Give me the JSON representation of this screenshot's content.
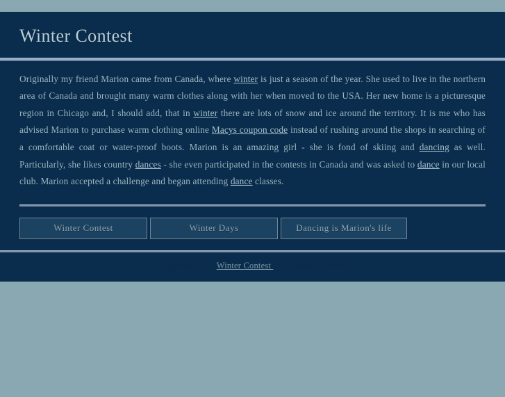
{
  "theme": {
    "page_background": "#8aa8b1",
    "content_background": "#0a2d4d",
    "body_text_color": "#9db4bf",
    "link_color": "#a9c0cb",
    "rule_color": "#93a9c4",
    "button_background": "#1b4260",
    "button_border": "#6f8797",
    "button_text_color": "#8ea4b0",
    "footer_text_color": "#0d2c44"
  },
  "header": {
    "title": "Winter Contest"
  },
  "article": {
    "segments": [
      {
        "type": "text",
        "value": "Originally my friend Marion came from Canada, where "
      },
      {
        "type": "link",
        "value": "winter"
      },
      {
        "type": "text",
        "value": " is just a season of the year. She used to live in the northern area of Canada and brought many warm clothes along with her when moved to the USA. Her new home is a picturesque region in Chicago and, I should add, that in "
      },
      {
        "type": "link",
        "value": "winter"
      },
      {
        "type": "text",
        "value": " there are lots of snow and ice around the territory. It is me who has advised Marion to purchase warm clothing online "
      },
      {
        "type": "link",
        "value": "Macys coupon code"
      },
      {
        "type": "text",
        "value": " instead of rushing around the shops in searching of a comfortable coat or water-proof boots. Marion is an amazing girl - she is fond of skiing and "
      },
      {
        "type": "link",
        "value": "dancing"
      },
      {
        "type": "text",
        "value": " as well. Particularly, she likes country "
      },
      {
        "type": "link",
        "value": "dances"
      },
      {
        "type": "text",
        "value": " - she even participated in the contests in Canada and was asked to "
      },
      {
        "type": "link",
        "value": "dance"
      },
      {
        "type": "text",
        "value": " in our local club. Marion accepted a challenge and began attending "
      },
      {
        "type": "link",
        "value": "dance"
      },
      {
        "type": "text",
        "value": " classes."
      }
    ],
    "text_1": "Originally my friend Marion came from Canada, where ",
    "link_winter_1": "winter",
    "text_2": " is just a season of the year. She used to live in the northern area of Canada and brought many warm clothes along with her when moved to the USA. Her new home is a picturesque region in Chicago and, I should add, that in ",
    "link_winter_2": "winter",
    "text_3": " there are lots of snow and ice around the territory. It is me who has advised Marion to purchase warm clothing online ",
    "link_macys": "Macys coupon code",
    "text_4": " instead of rushing around the shops in searching of a comfortable coat or water-proof boots. Marion is an amazing girl - she is fond of skiing and ",
    "link_dancing": "dancing",
    "text_5": " as well. Particularly, she likes country ",
    "link_dances": "dances",
    "text_6": " - she even participated in the contests in Canada and was asked to ",
    "link_dance_1": "dance",
    "text_7": " in our local club. Marion accepted a challenge and began attending ",
    "link_dance_2": "dance",
    "text_8": " classes."
  },
  "nav": {
    "buttons": [
      {
        "label": "Winter Contest"
      },
      {
        "label": "Winter Days"
      },
      {
        "label": "Dancing is Marion's life"
      }
    ]
  },
  "footer": {
    "copyright_prefix": "Copyright 2011 ",
    "link_label": "Winter Contest ",
    "copyright_suffix": ". All rights reserved."
  }
}
